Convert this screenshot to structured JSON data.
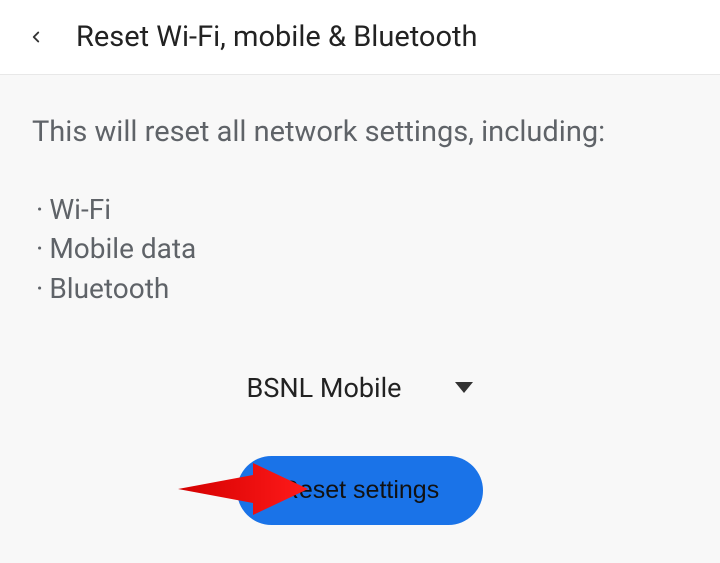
{
  "header": {
    "title": "Reset Wi-Fi, mobile & Bluetooth"
  },
  "content": {
    "description": "This will reset all network settings, including:",
    "items": [
      "Wi-Fi",
      "Mobile data",
      "Bluetooth"
    ]
  },
  "carrier": {
    "selected": "BSNL Mobile"
  },
  "actions": {
    "reset_label": "Reset settings"
  }
}
